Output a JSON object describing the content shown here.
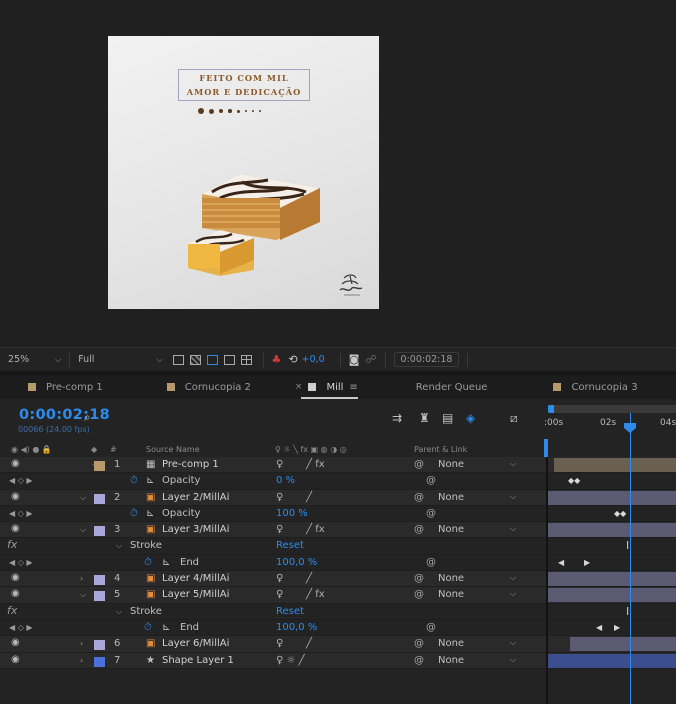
{
  "canvas": {
    "title_line1": "FEITO COM MIL",
    "title_line2": "AMOR E DEDICAÇÃO",
    "bg_color": "#e8e8e8",
    "accent_color": "#8a5a2c"
  },
  "viewer_bar": {
    "zoom": "25%",
    "resolution": "Full",
    "exposure": "+0,0",
    "timecode": "0:00:02:18"
  },
  "tabs": [
    {
      "label": "Pre-comp 1",
      "color": "#b89a6a"
    },
    {
      "label": "Cornucopia 2",
      "color": "#b89a6a"
    },
    {
      "label": "Mill",
      "color": "#c8c8c8",
      "active": true
    },
    {
      "label": "Render Queue"
    },
    {
      "label": "Cornucopia 3",
      "color": "#b89a6a"
    }
  ],
  "timeline": {
    "timecode": "0:00:02:18",
    "frames": "00066 (24.00 fps)",
    "search_placeholder": "",
    "ruler_labels": [
      ":00s",
      "02s",
      "04s"
    ],
    "headers": {
      "source_name": "Source Name",
      "parent_link": "Parent & Link",
      "hash": "#"
    },
    "rows": [
      {
        "kind": "layer",
        "num": "1",
        "name": "Pre-comp 1",
        "label_color": "#b89a6a",
        "icon": "precomp-icon",
        "switches": "fx",
        "parent": "None"
      },
      {
        "kind": "prop",
        "name": "Opacity",
        "value": "0 %"
      },
      {
        "kind": "layer",
        "num": "2",
        "name": "Layer 2/MillAi",
        "label_color": "#a8a8d8",
        "icon": "ai-icon",
        "switches": "slash",
        "parent": "None"
      },
      {
        "kind": "prop",
        "name": "Opacity",
        "value": "100 %"
      },
      {
        "kind": "layer",
        "num": "3",
        "name": "Layer 3/MillAi",
        "label_color": "#a8a8d8",
        "icon": "ai-icon",
        "switches": "fx",
        "parent": "None"
      },
      {
        "kind": "effect",
        "name": "Stroke",
        "value": "Reset"
      },
      {
        "kind": "prop",
        "name": "End",
        "value": "100,0 %"
      },
      {
        "kind": "layer",
        "num": "4",
        "name": "Layer 4/MillAi",
        "label_color": "#a8a8d8",
        "icon": "ai-icon",
        "switches": "slash",
        "parent": "None"
      },
      {
        "kind": "layer",
        "num": "5",
        "name": "Layer 5/MillAi",
        "label_color": "#a8a8d8",
        "icon": "ai-icon",
        "switches": "fx",
        "parent": "None"
      },
      {
        "kind": "effect",
        "name": "Stroke",
        "value": "Reset"
      },
      {
        "kind": "prop",
        "name": "End",
        "value": "100,0 %"
      },
      {
        "kind": "layer",
        "num": "6",
        "name": "Layer 6/MillAi",
        "label_color": "#a8a8d8",
        "icon": "ai-icon",
        "switches": "slash",
        "parent": "None"
      },
      {
        "kind": "layer",
        "num": "7",
        "name": "Shape Layer 1",
        "label_color": "#4a72d8",
        "icon": "star-icon",
        "switches": "star-slash",
        "parent": "None"
      }
    ]
  }
}
